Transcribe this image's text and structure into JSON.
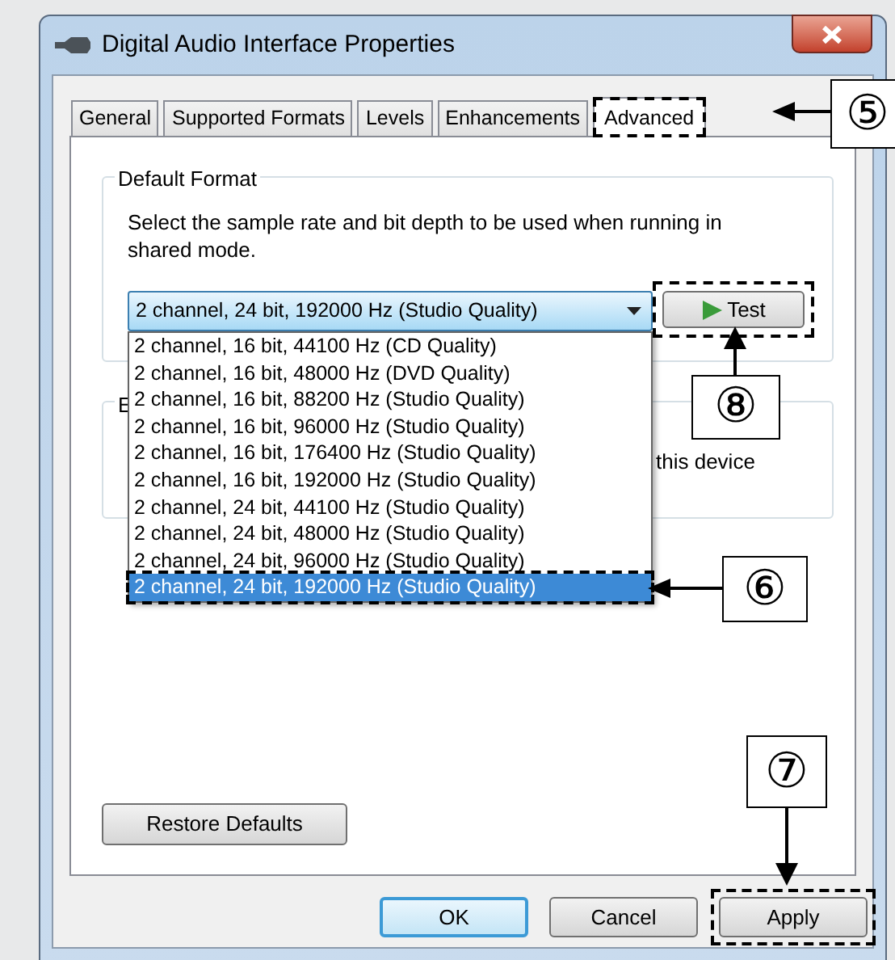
{
  "window": {
    "title": "Digital Audio Interface Properties"
  },
  "tabs": [
    {
      "label": "General",
      "selected": false,
      "highlighted": false
    },
    {
      "label": "Supported Formats",
      "selected": false,
      "highlighted": false
    },
    {
      "label": "Levels",
      "selected": false,
      "highlighted": false
    },
    {
      "label": "Enhancements",
      "selected": false,
      "highlighted": false
    },
    {
      "label": "Advanced",
      "selected": true,
      "highlighted": true
    }
  ],
  "default_format": {
    "group_label": "Default Format",
    "description": "Select the sample rate and bit depth to be used when running in shared mode.",
    "combo_value": "2 channel, 24 bit, 192000 Hz (Studio Quality)",
    "expanded": true,
    "options": [
      {
        "label": "2 channel, 16 bit, 44100 Hz (CD Quality)",
        "selected": false,
        "highlighted": false
      },
      {
        "label": "2 channel, 16 bit, 48000 Hz (DVD Quality)",
        "selected": false,
        "highlighted": false
      },
      {
        "label": "2 channel, 16 bit, 88200 Hz (Studio Quality)",
        "selected": false,
        "highlighted": false
      },
      {
        "label": "2 channel, 16 bit, 96000 Hz (Studio Quality)",
        "selected": false,
        "highlighted": false
      },
      {
        "label": "2 channel, 16 bit, 176400 Hz (Studio Quality)",
        "selected": false,
        "highlighted": false
      },
      {
        "label": "2 channel, 16 bit, 192000 Hz (Studio Quality)",
        "selected": false,
        "highlighted": false
      },
      {
        "label": "2 channel, 24 bit, 44100 Hz (Studio Quality)",
        "selected": false,
        "highlighted": false
      },
      {
        "label": "2 channel, 24 bit, 48000 Hz (Studio Quality)",
        "selected": false,
        "highlighted": false
      },
      {
        "label": "2 channel, 24 bit, 96000 Hz (Studio Quality)",
        "selected": false,
        "highlighted": false
      },
      {
        "label": "2 channel, 24 bit, 192000 Hz (Studio Quality)",
        "selected": true,
        "highlighted": true
      }
    ],
    "test_button": {
      "label": "Test",
      "highlighted": true
    }
  },
  "second_group": {
    "label": "E",
    "text": "this device"
  },
  "restore_button": {
    "label": "Restore Defaults"
  },
  "buttons": [
    {
      "label": "OK",
      "default": true,
      "highlighted": false
    },
    {
      "label": "Cancel",
      "default": false,
      "highlighted": false
    },
    {
      "label": "Apply",
      "default": false,
      "highlighted": true
    }
  ],
  "callouts": [
    {
      "label": "⑤",
      "kind": "left"
    },
    {
      "label": "⑧",
      "kind": "up"
    },
    {
      "label": "⑥",
      "kind": "left"
    },
    {
      "label": "⑦",
      "kind": "down"
    }
  ]
}
